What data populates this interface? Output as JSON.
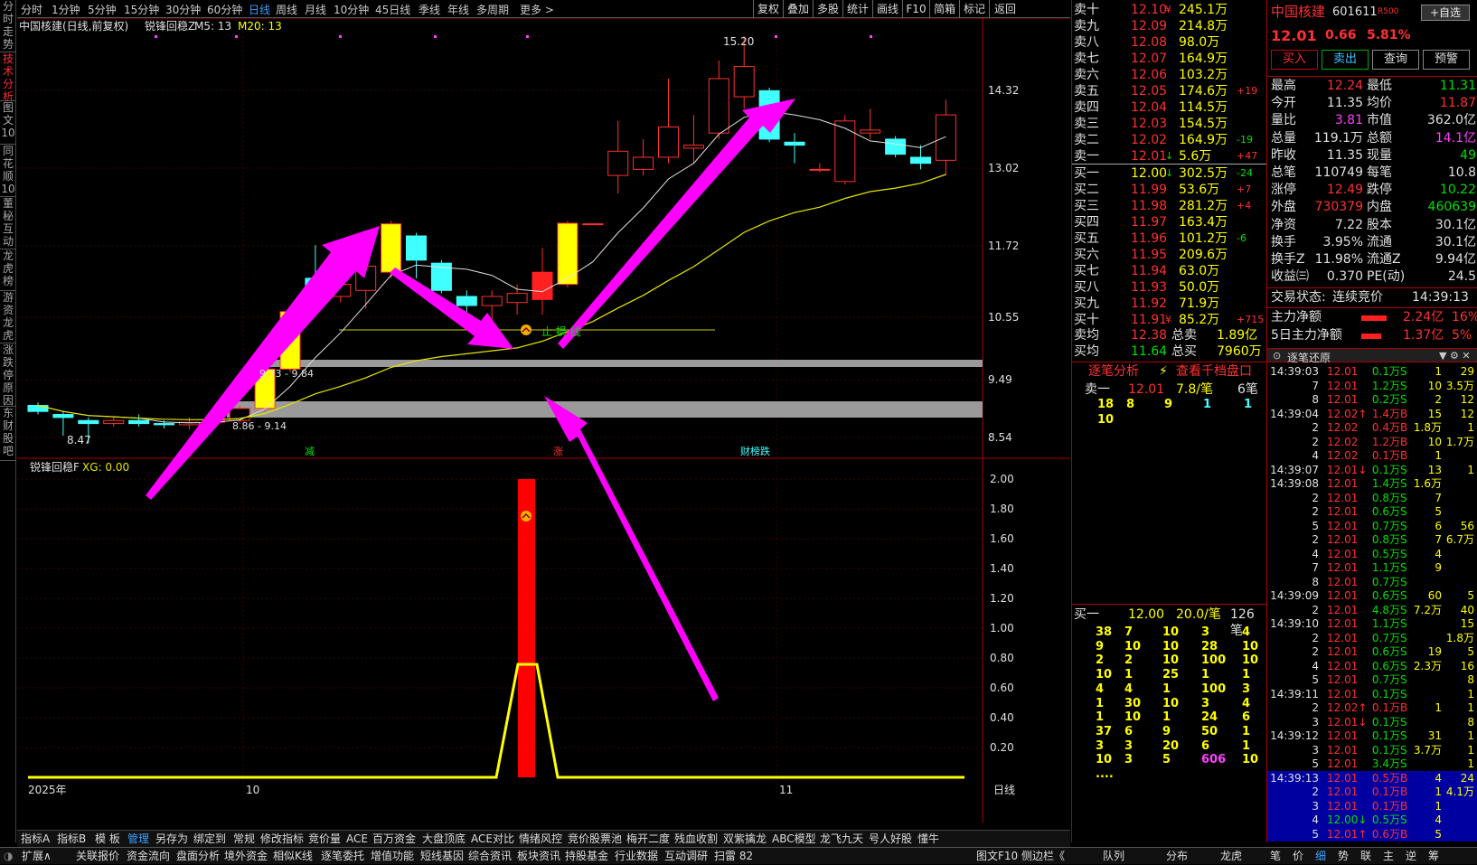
{
  "left_tabs": [
    "分时走势",
    "技术分析",
    "图文10",
    "同花顺10",
    "董秘互动",
    "龙虎榜",
    "游资龙虎",
    "涨跌停原因",
    "东财股吧"
  ],
  "periods": [
    "分时",
    "1分钟",
    "5分钟",
    "15分钟",
    "30分钟",
    "60分钟",
    "日线",
    "周线",
    "月线",
    "10分钟",
    "45日线",
    "季线",
    "年线",
    "多周期",
    "更多 >"
  ],
  "active_period": "日线",
  "toolbar_right": [
    "复权",
    "叠加",
    "多股",
    "统计",
    "画线",
    "F10",
    "简箱",
    "标记",
    "返回"
  ],
  "chart": {
    "title": "中国核建(日线,前复权)",
    "indicator": "锐锋回稳Z",
    "ma5": "M5: 13",
    "ma20": "M20: 13",
    "price_ticks": [
      "14.32",
      "13.02",
      "11.72",
      "10.55",
      "9.49",
      "8.54"
    ],
    "high_label": "15.20",
    "low_label": "8.47",
    "zone_label_1": "9.73 - 9.84",
    "zone_label_2": "8.86 - 9.14",
    "stop_label": "止 损 线",
    "event_labels": [
      "减",
      "涨",
      "财榜跌"
    ],
    "sub_indicator": "锐锋回稳F",
    "sub_value": "XG: 0.00",
    "sub_ticks": [
      "2.00",
      "1.80",
      "1.60",
      "1.40",
      "1.20",
      "1.00",
      "0.80",
      "0.60",
      "0.40",
      "0.20"
    ],
    "date_labels": [
      "2025年",
      "10",
      "11"
    ],
    "period_label": "日线",
    "candles": [
      {
        "o": 9.0,
        "c": 9.1,
        "h": 9.15,
        "l": 8.95,
        "col": "cyan"
      },
      {
        "o": 8.95,
        "c": 8.9,
        "h": 9.0,
        "l": 8.6,
        "col": "cyan"
      },
      {
        "o": 8.85,
        "c": 8.8,
        "h": 8.9,
        "l": 8.47,
        "col": "cyan"
      },
      {
        "o": 8.8,
        "c": 8.85,
        "h": 8.9,
        "l": 8.75,
        "col": "red"
      },
      {
        "o": 8.85,
        "c": 8.8,
        "h": 8.95,
        "l": 8.75,
        "col": "cyan"
      },
      {
        "o": 8.8,
        "c": 8.78,
        "h": 8.85,
        "l": 8.72,
        "col": "cyan"
      },
      {
        "o": 8.78,
        "c": 8.82,
        "h": 8.9,
        "l": 8.7,
        "col": "red"
      },
      {
        "o": 8.82,
        "c": 8.85,
        "h": 8.95,
        "l": 8.75,
        "col": "red"
      },
      {
        "o": 8.85,
        "c": 9.05,
        "h": 9.1,
        "l": 8.8,
        "col": "red"
      },
      {
        "o": 9.05,
        "c": 9.7,
        "h": 9.75,
        "l": 9.0,
        "col": "yellow"
      },
      {
        "o": 9.7,
        "c": 10.65,
        "h": 10.7,
        "l": 9.65,
        "col": "yellow"
      },
      {
        "o": 11.0,
        "c": 11.2,
        "h": 11.75,
        "l": 10.7,
        "col": "cyan"
      },
      {
        "o": 11.1,
        "c": 10.9,
        "h": 11.3,
        "l": 10.8,
        "col": "red"
      },
      {
        "o": 11.0,
        "c": 11.4,
        "h": 11.5,
        "l": 10.7,
        "col": "red"
      },
      {
        "o": 11.3,
        "c": 12.1,
        "h": 12.15,
        "l": 11.2,
        "col": "yellow"
      },
      {
        "o": 11.9,
        "c": 11.5,
        "h": 11.95,
        "l": 11.2,
        "col": "cyan"
      },
      {
        "o": 11.45,
        "c": 11.0,
        "h": 11.5,
        "l": 10.95,
        "col": "cyan"
      },
      {
        "o": 10.9,
        "c": 10.75,
        "h": 11.0,
        "l": 10.6,
        "col": "cyan"
      },
      {
        "o": 10.75,
        "c": 10.9,
        "h": 11.0,
        "l": 10.5,
        "col": "red"
      },
      {
        "o": 10.8,
        "c": 10.95,
        "h": 11.1,
        "l": 10.6,
        "col": "red"
      },
      {
        "o": 10.85,
        "c": 11.3,
        "h": 11.7,
        "l": 10.6,
        "col": "solidred"
      },
      {
        "o": 11.1,
        "c": 12.11,
        "h": 12.15,
        "l": 11.05,
        "col": "yellow"
      },
      {
        "o": 12.1,
        "c": 12.1,
        "h": 12.1,
        "l": 12.1,
        "col": "red"
      },
      {
        "o": 12.9,
        "c": 13.3,
        "h": 13.8,
        "l": 12.6,
        "col": "red"
      },
      {
        "o": 13.2,
        "c": 13.0,
        "h": 13.5,
        "l": 12.9,
        "col": "red"
      },
      {
        "o": 13.2,
        "c": 13.7,
        "h": 14.5,
        "l": 13.1,
        "col": "red"
      },
      {
        "o": 13.35,
        "c": 13.4,
        "h": 13.9,
        "l": 13.1,
        "col": "red"
      },
      {
        "o": 13.6,
        "c": 14.5,
        "h": 14.8,
        "l": 13.5,
        "col": "red"
      },
      {
        "o": 14.2,
        "c": 14.7,
        "h": 15.2,
        "l": 14.0,
        "col": "red"
      },
      {
        "o": 14.3,
        "c": 13.5,
        "h": 14.35,
        "l": 13.45,
        "col": "cyan"
      },
      {
        "o": 13.45,
        "c": 13.4,
        "h": 13.6,
        "l": 13.1,
        "col": "cyan"
      },
      {
        "o": 13.0,
        "c": 13.0,
        "h": 13.1,
        "l": 12.95,
        "col": "red"
      },
      {
        "o": 12.8,
        "c": 13.8,
        "h": 13.9,
        "l": 12.75,
        "col": "red"
      },
      {
        "o": 13.6,
        "c": 13.65,
        "h": 14.0,
        "l": 13.5,
        "col": "red"
      },
      {
        "o": 13.5,
        "c": 13.25,
        "h": 13.55,
        "l": 13.2,
        "col": "cyan"
      },
      {
        "o": 13.2,
        "c": 13.1,
        "h": 13.4,
        "l": 13.0,
        "col": "cyan"
      },
      {
        "o": 13.15,
        "c": 13.9,
        "h": 14.15,
        "l": 12.9,
        "col": "red"
      }
    ]
  },
  "stock": {
    "name": "中国核建",
    "code": "601611",
    "tag": "R500",
    "btn_fav": "+自选",
    "price": "12.01",
    "change": "0.66",
    "pct": "5.81%",
    "buy": "买入",
    "sell": "卖出",
    "query": "查询",
    "alert": "预警"
  },
  "asks": [
    {
      "l": "卖十",
      "p": "12.10",
      "v": "245.1万",
      "d": "",
      "s": "¥"
    },
    {
      "l": "卖九",
      "p": "12.09",
      "v": "214.8万",
      "d": "",
      "s": ""
    },
    {
      "l": "卖八",
      "p": "12.08",
      "v": "98.0万",
      "d": "",
      "s": ""
    },
    {
      "l": "卖七",
      "p": "12.07",
      "v": "164.9万",
      "d": "",
      "s": ""
    },
    {
      "l": "卖六",
      "p": "12.06",
      "v": "103.2万",
      "d": "",
      "s": ""
    },
    {
      "l": "卖五",
      "p": "12.05",
      "v": "174.6万",
      "d": "+19",
      "s": ""
    },
    {
      "l": "卖四",
      "p": "12.04",
      "v": "114.5万",
      "d": "",
      "s": ""
    },
    {
      "l": "卖三",
      "p": "12.03",
      "v": "154.5万",
      "d": "",
      "s": ""
    },
    {
      "l": "卖二",
      "p": "12.02",
      "v": "164.9万",
      "d": "-19",
      "s": ""
    },
    {
      "l": "卖一",
      "p": "12.01",
      "v": "5.6万",
      "d": "+47",
      "s": "↓"
    }
  ],
  "bids": [
    {
      "l": "买一",
      "p": "12.00",
      "v": "302.5万",
      "d": "-24",
      "s": "↓"
    },
    {
      "l": "买二",
      "p": "11.99",
      "v": "53.6万",
      "d": "+7",
      "s": ""
    },
    {
      "l": "买三",
      "p": "11.98",
      "v": "281.2万",
      "d": "+4",
      "s": ""
    },
    {
      "l": "买四",
      "p": "11.97",
      "v": "163.4万",
      "d": "",
      "s": ""
    },
    {
      "l": "买五",
      "p": "11.96",
      "v": "101.2万",
      "d": "-6",
      "s": ""
    },
    {
      "l": "买六",
      "p": "11.95",
      "v": "209.6万",
      "d": "",
      "s": ""
    },
    {
      "l": "买七",
      "p": "11.94",
      "v": "63.0万",
      "d": "",
      "s": ""
    },
    {
      "l": "买八",
      "p": "11.93",
      "v": "50.0万",
      "d": "",
      "s": ""
    },
    {
      "l": "买九",
      "p": "11.92",
      "v": "71.9万",
      "d": "",
      "s": ""
    },
    {
      "l": "买十",
      "p": "11.91",
      "v": "85.2万",
      "d": "+715",
      "s": "¥"
    }
  ],
  "avg": {
    "sell_l": "卖均",
    "sell_p": "12.38",
    "sell_t": "总卖",
    "sell_v": "1.89亿",
    "buy_l": "买均",
    "buy_p": "11.64",
    "buy_t": "总买",
    "buy_v": "7960万"
  },
  "queue": {
    "tab1": "逐笔分析",
    "tab2": "查看千档盘口",
    "ask_l": "卖一",
    "ask_p": "12.01",
    "ask_per": "7.8/笔",
    "ask_cnt": "6笔",
    "ask_orders": [
      [
        "18",
        "8",
        "9",
        "1",
        "1"
      ],
      [
        "10",
        "",
        "",
        "",
        ""
      ]
    ],
    "bid_l": "买一",
    "bid_p": "12.00",
    "bid_per": "20.0/笔",
    "bid_cnt": "126笔",
    "bid_orders": [
      [
        "38",
        "7",
        "10",
        "3",
        "4"
      ],
      [
        "9",
        "10",
        "10",
        "28",
        "10"
      ],
      [
        "2",
        "2",
        "10",
        "100",
        "10"
      ],
      [
        "10",
        "1",
        "25",
        "1",
        "1"
      ],
      [
        "4",
        "4",
        "1",
        "100",
        "3"
      ],
      [
        "1",
        "30",
        "10",
        "3",
        "4"
      ],
      [
        "1",
        "10",
        "1",
        "24",
        "6"
      ],
      [
        "37",
        "6",
        "9",
        "50",
        "1"
      ],
      [
        "3",
        "3",
        "20",
        "6",
        "1"
      ],
      [
        "10",
        "3",
        "5",
        "606",
        "10"
      ],
      [
        "....",
        "",
        "",
        "",
        ""
      ]
    ]
  },
  "quotes": [
    {
      "a": "最高",
      "av": "12.24",
      "b": "最低",
      "bv": "11.31",
      "ac": "r",
      "bc": "g"
    },
    {
      "a": "今开",
      "av": "11.35",
      "b": "均价",
      "bv": "11.87",
      "ac": "w",
      "bc": "r"
    },
    {
      "a": "量比",
      "av": "3.81",
      "b": "市值",
      "bv": "362.0亿",
      "ac": "m",
      "bc": "w"
    },
    {
      "a": "总量",
      "av": "119.1万",
      "b": "总额",
      "bv": "14.1亿",
      "ac": "w",
      "bc": "m"
    },
    {
      "a": "昨收",
      "av": "11.35",
      "b": "现量",
      "bv": "49",
      "ac": "w",
      "bc": "g"
    },
    {
      "a": "总笔",
      "av": "110749",
      "b": "每笔",
      "bv": "10.8",
      "ac": "w",
      "bc": "w"
    },
    {
      "a": "涨停",
      "av": "12.49",
      "b": "跌停",
      "bv": "10.22",
      "ac": "r",
      "bc": "g"
    },
    {
      "a": "外盘",
      "av": "730379",
      "b": "内盘",
      "bv": "460639",
      "ac": "r",
      "bc": "g"
    },
    {
      "a": "净资",
      "av": "7.22",
      "b": "股本",
      "bv": "30.1亿",
      "ac": "w",
      "bc": "w"
    },
    {
      "a": "换手",
      "av": "3.95%",
      "b": "流通",
      "bv": "30.1亿",
      "ac": "w",
      "bc": "w"
    },
    {
      "a": "换手Z",
      "av": "11.98%",
      "b": "流通Z",
      "bv": "9.94亿",
      "ac": "w",
      "bc": "w"
    },
    {
      "a": "收益㈢",
      "av": "0.370",
      "b": "PE(动)",
      "bv": "24.5",
      "ac": "w",
      "bc": "w"
    }
  ],
  "trade_state": {
    "label": "交易状态:",
    "value": "连续竞价",
    "time": "14:39:13"
  },
  "flow": [
    {
      "l": "主力净额",
      "v": "2.24亿",
      "p": "16%"
    },
    {
      "l": "5日主力净额",
      "v": "1.37亿",
      "p": "5%"
    }
  ],
  "ticks_title": "逐笔还原",
  "ticks": [
    {
      "t": "14:39:03",
      "p": "12.01",
      "v": "0.1万",
      "s": "S",
      "n": "1",
      "x": "29"
    },
    {
      "t": "7",
      "p": "12.01",
      "v": "1.2万",
      "s": "S",
      "n": "10",
      "x": "3.5万"
    },
    {
      "t": "8",
      "p": "12.01",
      "v": "0.2万",
      "s": "S",
      "n": "2",
      "x": "12"
    },
    {
      "t": "14:39:04",
      "p": "12.02↑",
      "v": "1.4万",
      "s": "B",
      "n": "15",
      "x": "12"
    },
    {
      "t": "2",
      "p": "12.02",
      "v": "0.4万",
      "s": "B",
      "n": "1.8万",
      "x": "1"
    },
    {
      "t": "2",
      "p": "12.02",
      "v": "1.2万",
      "s": "B",
      "n": "10",
      "x": "1.7万"
    },
    {
      "t": "4",
      "p": "12.02",
      "v": "0.1万",
      "s": "B",
      "n": "1",
      "x": ""
    },
    {
      "t": "14:39:07",
      "p": "12.01↓",
      "v": "0.1万",
      "s": "S",
      "n": "13",
      "x": "1"
    },
    {
      "t": "14:39:08",
      "p": "12.01",
      "v": "1.4万",
      "s": "S",
      "n": "1.6万",
      "x": ""
    },
    {
      "t": "2",
      "p": "12.01",
      "v": "0.8万",
      "s": "S",
      "n": "7",
      "x": ""
    },
    {
      "t": "2",
      "p": "12.01",
      "v": "0.6万",
      "s": "S",
      "n": "5",
      "x": ""
    },
    {
      "t": "5",
      "p": "12.01",
      "v": "0.7万",
      "s": "S",
      "n": "6",
      "x": "56"
    },
    {
      "t": "2",
      "p": "12.01",
      "v": "0.8万",
      "s": "S",
      "n": "7",
      "x": "6.7万"
    },
    {
      "t": "4",
      "p": "12.01",
      "v": "0.5万",
      "s": "S",
      "n": "4",
      "x": ""
    },
    {
      "t": "7",
      "p": "12.01",
      "v": "1.1万",
      "s": "S",
      "n": "9",
      "x": ""
    },
    {
      "t": "8",
      "p": "12.01",
      "v": "0.7万",
      "s": "S",
      "n": "",
      "x": ""
    },
    {
      "t": "14:39:09",
      "p": "12.01",
      "v": "0.6万",
      "s": "S",
      "n": "60",
      "x": "5"
    },
    {
      "t": "2",
      "p": "12.01",
      "v": "4.8万",
      "s": "S",
      "n": "7.2万",
      "x": "40"
    },
    {
      "t": "14:39:10",
      "p": "12.01",
      "v": "1.1万",
      "s": "S",
      "n": "",
      "x": "15"
    },
    {
      "t": "2",
      "p": "12.01",
      "v": "0.7万",
      "s": "S",
      "n": "",
      "x": "1.8万"
    },
    {
      "t": "2",
      "p": "12.01",
      "v": "0.6万",
      "s": "S",
      "n": "19",
      "x": "5"
    },
    {
      "t": "4",
      "p": "12.01",
      "v": "0.6万",
      "s": "S",
      "n": "2.3万",
      "x": "16"
    },
    {
      "t": "5",
      "p": "12.01",
      "v": "0.7万",
      "s": "S",
      "n": "",
      "x": "8"
    },
    {
      "t": "14:39:11",
      "p": "12.01",
      "v": "0.1万",
      "s": "S",
      "n": "",
      "x": "1"
    },
    {
      "t": "2",
      "p": "12.02↑",
      "v": "0.1万",
      "s": "B",
      "n": "1",
      "x": "1"
    },
    {
      "t": "3",
      "p": "12.01↓",
      "v": "0.1万",
      "s": "S",
      "n": "",
      "x": "8"
    },
    {
      "t": "14:39:12",
      "p": "12.01",
      "v": "0.1万",
      "s": "S",
      "n": "31",
      "x": "1"
    },
    {
      "t": "3",
      "p": "12.01",
      "v": "0.1万",
      "s": "S",
      "n": "3.7万",
      "x": "1"
    },
    {
      "t": "5",
      "p": "12.01",
      "v": "3.4万",
      "s": "S",
      "n": "",
      "x": "1"
    },
    {
      "t": "14:39:13",
      "p": "12.01",
      "v": "0.5万",
      "s": "B",
      "n": "4",
      "x": "24"
    },
    {
      "t": "2",
      "p": "12.01",
      "v": "0.1万",
      "s": "B",
      "n": "1",
      "x": "4.1万"
    },
    {
      "t": "3",
      "p": "12.01",
      "v": "0.1万",
      "s": "B",
      "n": "1",
      "x": ""
    },
    {
      "t": "4",
      "p": "12.00↓",
      "v": "0.5万",
      "s": "S",
      "n": "4",
      "x": ""
    },
    {
      "t": "5",
      "p": "12.01↑",
      "v": "0.6万",
      "s": "B",
      "n": "5",
      "x": ""
    }
  ],
  "bottom_tabs": [
    "指标A",
    "指标B",
    "模 板",
    "管理",
    "另存为",
    "绑定到",
    "常规",
    "修改指标",
    "竞价量",
    "ACE",
    "百万资金",
    "大盘顶底",
    "ACE对比",
    "情绪风控",
    "竞价股票池",
    "梅开二度",
    "残血收割",
    "双紫擒龙",
    "ABC模型",
    "龙飞九天",
    "号人好股",
    "懂牛"
  ],
  "status_items": [
    {
      "t": "扩展∧",
      "c": "w"
    },
    {
      "t": "关联报价",
      "c": "w"
    },
    {
      "t": "资金流向",
      "c": "w"
    },
    {
      "t": "盘面分析",
      "c": "y"
    },
    {
      "t": "境外资金",
      "c": "y"
    },
    {
      "t": "相似K线",
      "c": "w"
    },
    {
      "t": "逐笔委托",
      "c": "w"
    },
    {
      "t": "增值功能",
      "c": "r"
    },
    {
      "t": "短线基因",
      "c": "r"
    },
    {
      "t": "综合资讯",
      "c": "y"
    },
    {
      "t": "板块资讯",
      "c": "y"
    },
    {
      "t": "持股基金",
      "c": "w"
    },
    {
      "t": "行业数据",
      "c": "w"
    },
    {
      "t": "互动调研",
      "c": "y"
    },
    {
      "t": "扫雷 82",
      "c": "w"
    }
  ],
  "status_right": [
    "图文F10",
    "侧边栏《",
    "队列",
    "分布",
    "龙虎",
    "笔",
    "价",
    "细",
    "势",
    "联",
    "主",
    "逆",
    "筹"
  ]
}
